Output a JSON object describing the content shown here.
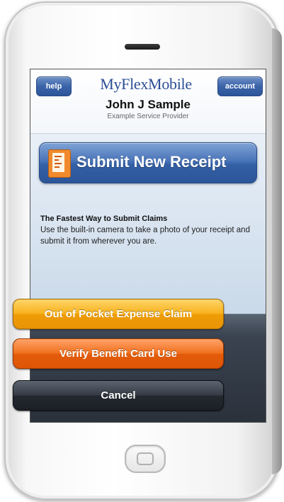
{
  "header": {
    "help_label": "help",
    "brand_name": "MyFlexMobile",
    "account_label": "account",
    "user_name": "John J Sample",
    "provider": "Example Service Provider"
  },
  "main": {
    "submit_label": "Submit New Receipt",
    "info_title": "The Fastest Way to Submit Claims",
    "info_body": "Use the built-in camera to take a photo of your receipt and submit it from wherever you are."
  },
  "action_sheet": {
    "options": [
      {
        "label": "Out of Pocket Expense Claim",
        "color": "#f7b21e"
      },
      {
        "label": "Verify Benefit Card Use",
        "color": "#f0701e"
      },
      {
        "label": "Cancel",
        "color": "#2a313b"
      }
    ]
  },
  "icons": {
    "receipt": "receipt-icon",
    "home": "home-button"
  },
  "colors": {
    "brand": "#2c4f95",
    "nav_button": "#3a63a8"
  }
}
